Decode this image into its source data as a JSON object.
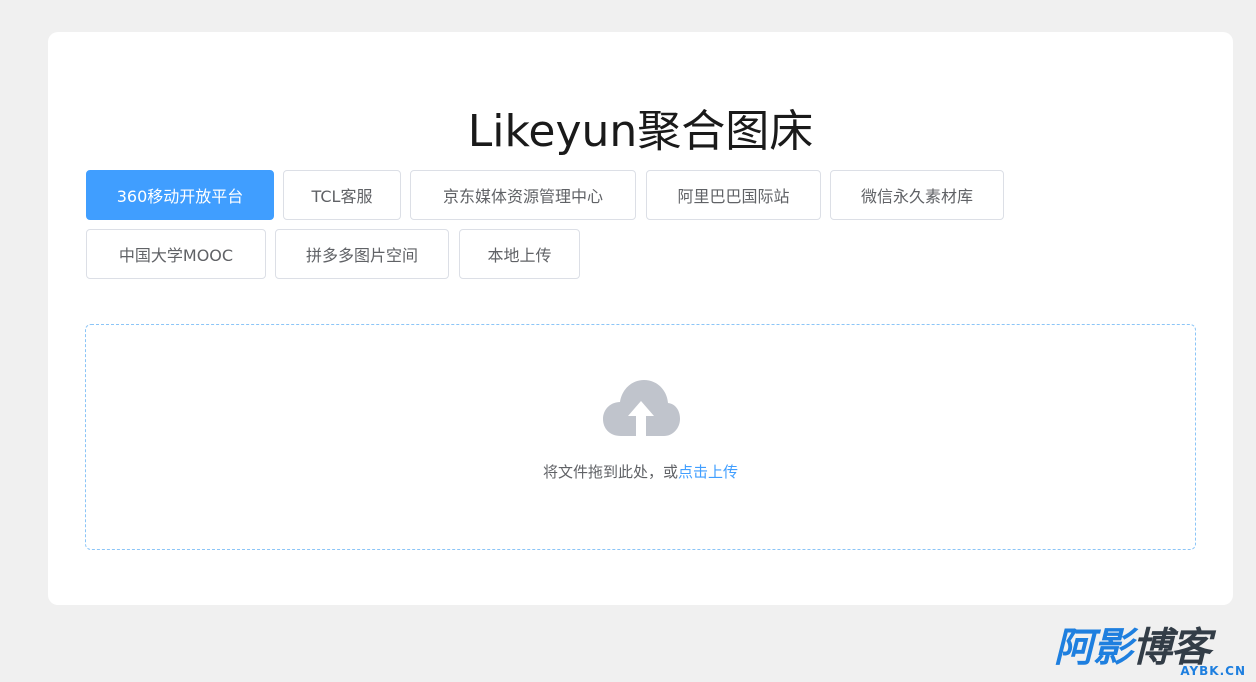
{
  "page": {
    "title": "Likeyun聚合图床"
  },
  "tabs": [
    {
      "label": "360移动开放平台",
      "active": true
    },
    {
      "label": "TCL客服",
      "active": false
    },
    {
      "label": "京东媒体资源管理中心",
      "active": false
    },
    {
      "label": "阿里巴巴国际站",
      "active": false
    },
    {
      "label": "微信永久素材库",
      "active": false
    },
    {
      "label": "中国大学MOOC",
      "active": false
    },
    {
      "label": "拼多多图片空间",
      "active": false
    },
    {
      "label": "本地上传",
      "active": false
    }
  ],
  "upload": {
    "icon": "cloud-upload-icon",
    "text_prefix": "将文件拖到此处，或",
    "text_link": "点击上传"
  },
  "watermark": {
    "main_part1": "阿影",
    "main_part2": "博客",
    "sub": "AYBK.CN"
  },
  "colors": {
    "accent": "#409eff",
    "background": "#f0f0f0",
    "card": "#ffffff",
    "border": "#dcdfe6",
    "upload_border": "#8cc5f7",
    "icon_gray": "#c0c4cc",
    "watermark_blue": "#1e7fdf"
  }
}
